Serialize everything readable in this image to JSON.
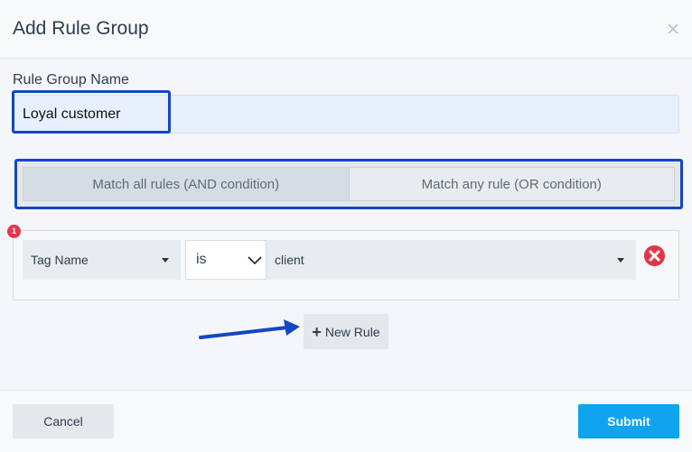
{
  "dialog": {
    "title": "Add Rule Group",
    "close_icon": "close-icon"
  },
  "form": {
    "name_label": "Rule Group Name",
    "name_value": "Loyal customer"
  },
  "match_mode": {
    "options": [
      {
        "label": "Match all rules (AND condition)",
        "selected": true
      },
      {
        "label": "Match any rule (OR condition)",
        "selected": false
      }
    ]
  },
  "rules": [
    {
      "index_badge": "1",
      "field": "Tag Name",
      "operator": "is",
      "value": "client",
      "remove_icon": "remove-circle-icon"
    }
  ],
  "actions": {
    "new_rule_label": "New Rule",
    "cancel_label": "Cancel",
    "submit_label": "Submit"
  },
  "colors": {
    "highlight_border": "#1346c4",
    "submit_bg": "#0ea4ee",
    "remove_red": "#e3344a",
    "input_bg": "#e8f0fe"
  }
}
